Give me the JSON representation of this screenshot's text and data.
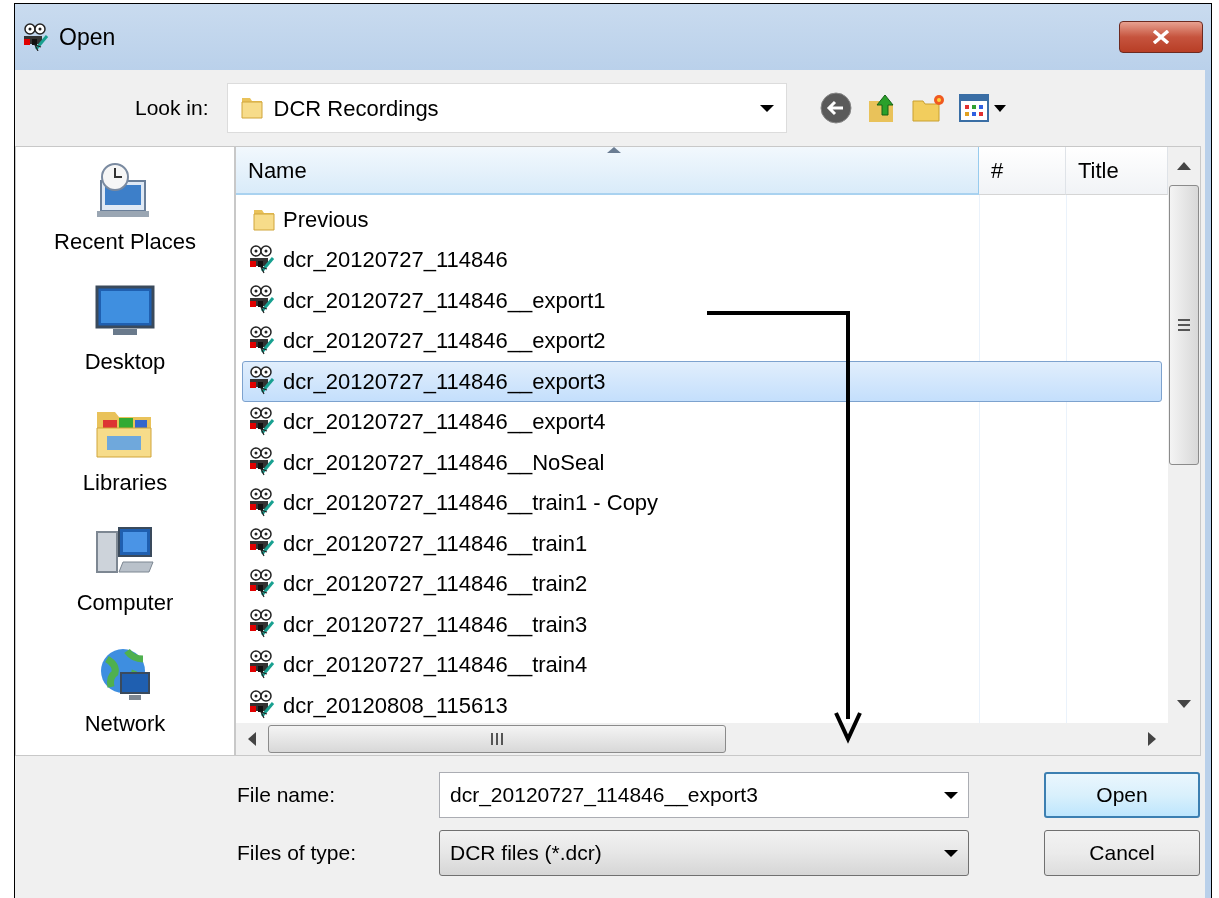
{
  "window": {
    "title": "Open"
  },
  "look_in": {
    "label": "Look in:",
    "value": "DCR Recordings"
  },
  "places": [
    {
      "label": "Recent Places",
      "kind": "recent"
    },
    {
      "label": "Desktop",
      "kind": "desktop"
    },
    {
      "label": "Libraries",
      "kind": "libraries"
    },
    {
      "label": "Computer",
      "kind": "computer"
    },
    {
      "label": "Network",
      "kind": "network"
    }
  ],
  "file_list": {
    "columns": [
      {
        "label": "Name",
        "sorted": true
      },
      {
        "label": "#",
        "sorted": false
      },
      {
        "label": "Title",
        "sorted": false
      }
    ],
    "rows": [
      {
        "name": "Previous",
        "kind": "folder",
        "selected": false
      },
      {
        "name": "dcr_20120727_114846",
        "kind": "recording",
        "selected": false
      },
      {
        "name": "dcr_20120727_114846__export1",
        "kind": "recording",
        "selected": false
      },
      {
        "name": "dcr_20120727_114846__export2",
        "kind": "recording",
        "selected": false
      },
      {
        "name": "dcr_20120727_114846__export3",
        "kind": "recording",
        "selected": true
      },
      {
        "name": "dcr_20120727_114846__export4",
        "kind": "recording",
        "selected": false
      },
      {
        "name": "dcr_20120727_114846__NoSeal",
        "kind": "recording",
        "selected": false
      },
      {
        "name": "dcr_20120727_114846__train1 - Copy",
        "kind": "recording",
        "selected": false
      },
      {
        "name": "dcr_20120727_114846__train1",
        "kind": "recording",
        "selected": false
      },
      {
        "name": "dcr_20120727_114846__train2",
        "kind": "recording",
        "selected": false
      },
      {
        "name": "dcr_20120727_114846__train3",
        "kind": "recording",
        "selected": false
      },
      {
        "name": "dcr_20120727_114846__train4",
        "kind": "recording",
        "selected": false
      },
      {
        "name": "dcr_20120808_115613",
        "kind": "recording",
        "selected": false
      }
    ]
  },
  "file_name": {
    "label": "File name:",
    "value": "dcr_20120727_114846__export3"
  },
  "file_type": {
    "label": "Files of type:",
    "value": "DCR files (*.dcr)"
  },
  "buttons": [
    {
      "label": "Open",
      "default": true
    },
    {
      "label": "Cancel",
      "default": false
    }
  ]
}
